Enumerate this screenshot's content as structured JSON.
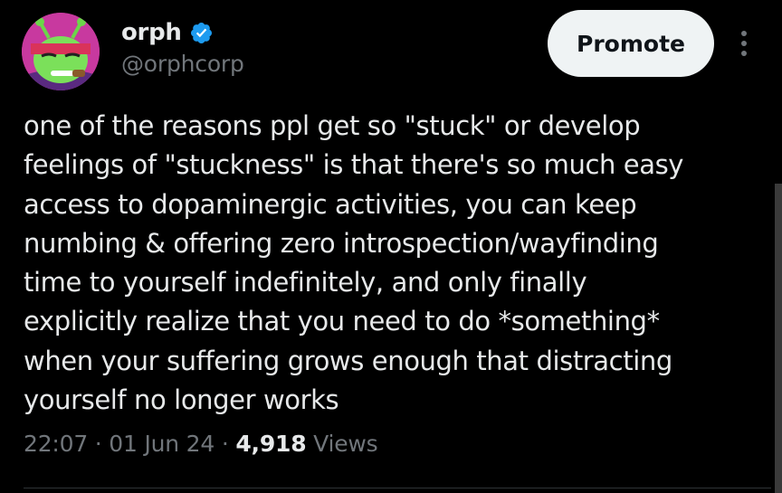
{
  "author": {
    "display_name": "orph",
    "handle": "@orphcorp",
    "verified": true
  },
  "actions": {
    "promote_label": "Promote",
    "more_icon": "more-vertical-icon"
  },
  "tweet": {
    "lines": [
      "one of the reasons ppl get so \"stuck\" or develop",
      "feelings of \"stuckness\" is that there's so much easy",
      "access to dopaminergic activities, you can keep",
      "numbing & offering zero introspection/wayfinding",
      "time to yourself indefinitely, and only finally",
      "explicitly realize that you need to do *something*",
      "when your suffering grows enough that distracting",
      "yourself no longer works"
    ]
  },
  "meta": {
    "time": "22:07",
    "separator": "·",
    "date": "01 Jun 24",
    "views_count": "4,918",
    "views_label": "Views"
  },
  "colors": {
    "background": "#000000",
    "text_primary": "#e7e9ea",
    "text_secondary": "#71767b",
    "verified": "#1d9bf0",
    "button_bg": "#eff3f4",
    "button_text": "#0f1419"
  }
}
